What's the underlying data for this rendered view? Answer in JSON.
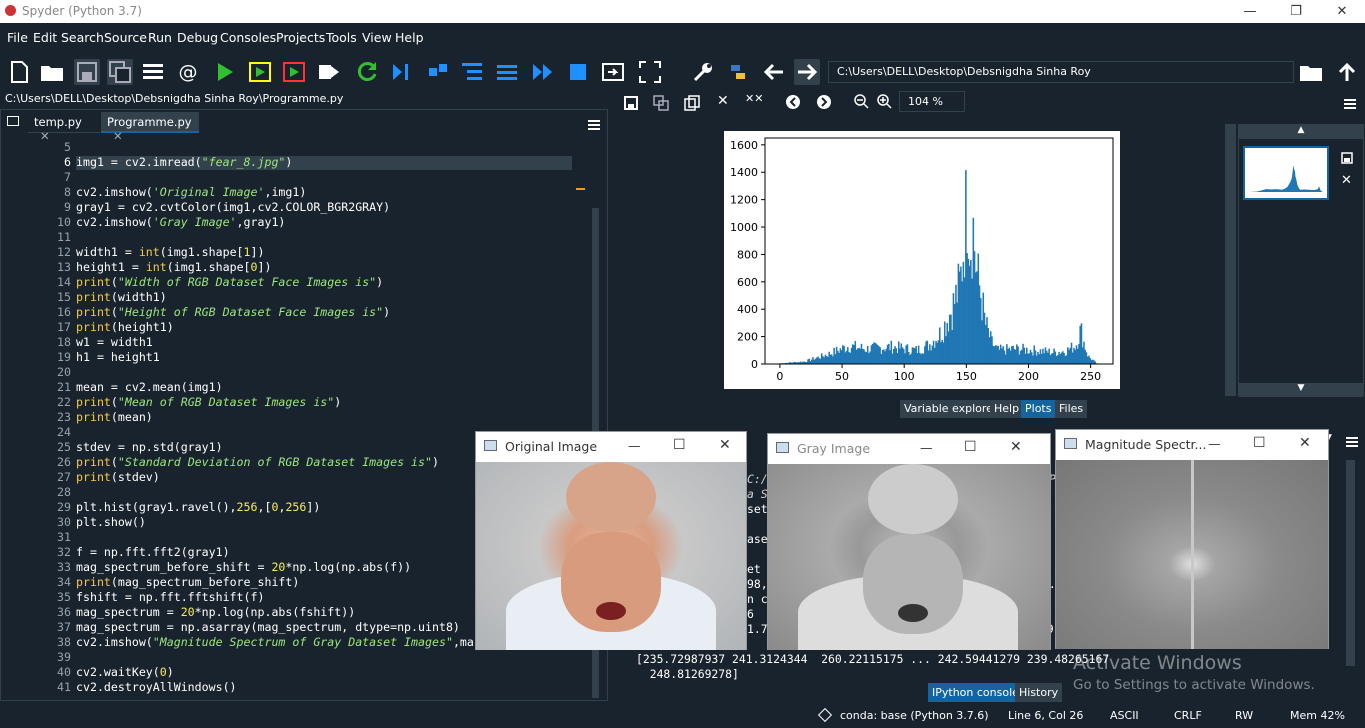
{
  "window": {
    "title": "Spyder (Python 3.7)",
    "min": "—",
    "restore": "❐",
    "close": "✕"
  },
  "menu": [
    "File",
    "Edit",
    "Search",
    "Source",
    "Run",
    "Debug",
    "Consoles",
    "Projects",
    "Tools",
    "View",
    "Help"
  ],
  "toolbar": {
    "path": "C:\\Users\\DELL\\Desktop\\Debsnigdha Sinha Roy"
  },
  "editor": {
    "path": "C:\\Users\\DELL\\Desktop\\Debsnigdha Sinha Roy\\Programme.py",
    "tabs": [
      {
        "label": "temp.py"
      },
      {
        "label": "Programme.py"
      }
    ],
    "tab_close": "✕",
    "lines": [
      {
        "n": "5",
        "t": ""
      },
      {
        "n": "6",
        "t": "img1 = cv2.imread(\"fear_8.jpg\")"
      },
      {
        "n": "7",
        "t": ""
      },
      {
        "n": "8",
        "t": "cv2.imshow('Original Image',img1)"
      },
      {
        "n": "9",
        "t": "gray1 = cv2.cvtColor(img1,cv2.COLOR_BGR2GRAY)"
      },
      {
        "n": "10",
        "t": "cv2.imshow('Gray Image',gray1)"
      },
      {
        "n": "11",
        "t": ""
      },
      {
        "n": "12",
        "t": "width1 = int(img1.shape[1])"
      },
      {
        "n": "13",
        "t": "height1 = int(img1.shape[0])"
      },
      {
        "n": "14",
        "t": "print(\"Width of RGB Dataset Face Images is\")"
      },
      {
        "n": "15",
        "t": "print(width1)"
      },
      {
        "n": "16",
        "t": "print(\"Height of RGB Dataset Face Images is\")"
      },
      {
        "n": "17",
        "t": "print(height1)"
      },
      {
        "n": "18",
        "t": "w1 = width1"
      },
      {
        "n": "19",
        "t": "h1 = height1"
      },
      {
        "n": "20",
        "t": ""
      },
      {
        "n": "21",
        "t": "mean = cv2.mean(img1)"
      },
      {
        "n": "22",
        "t": "print(\"Mean of RGB Dataset Images is\")"
      },
      {
        "n": "23",
        "t": "print(mean)"
      },
      {
        "n": "24",
        "t": ""
      },
      {
        "n": "25",
        "t": "stdev = np.std(gray1)"
      },
      {
        "n": "26",
        "t": "print(\"Standard Deviation of RGB Dataset Images is\")"
      },
      {
        "n": "27",
        "t": "print(stdev)"
      },
      {
        "n": "28",
        "t": ""
      },
      {
        "n": "29",
        "t": "plt.hist(gray1.ravel(),256,[0,256])"
      },
      {
        "n": "30",
        "t": "plt.show()"
      },
      {
        "n": "31",
        "t": ""
      },
      {
        "n": "32",
        "t": "f = np.fft.fft2(gray1)"
      },
      {
        "n": "33",
        "t": "mag_spectrum_before_shift = 20*np.log(np.abs(f))"
      },
      {
        "n": "34",
        "t": "print(mag_spectrum_before_shift)"
      },
      {
        "n": "35",
        "t": "fshift = np.fft.fftshift(f)"
      },
      {
        "n": "36",
        "t": "mag_spectrum = 20*np.log(np.abs(fshift))"
      },
      {
        "n": "37",
        "t": "mag_spectrum = np.asarray(mag_spectrum, dtype=np.uint8)"
      },
      {
        "n": "38",
        "t": "cv2.imshow(\"Magnitude Spectrum of Gray Dataset Images\",ma"
      },
      {
        "n": "39",
        "t": ""
      },
      {
        "n": "40",
        "t": "cv2.waitKey(0)"
      },
      {
        "n": "41",
        "t": "cv2.destroyAllWindows()"
      }
    ]
  },
  "plots": {
    "zoom": "104 %",
    "tabs": [
      "Variable explorer",
      "Help",
      "Plots",
      "Files"
    ],
    "active_tab": "Plots"
  },
  "chart_data": {
    "type": "bar",
    "xlim": [
      -12,
      268
    ],
    "ylim": [
      0,
      1650
    ],
    "xticks": [
      "0",
      "50",
      "100",
      "150",
      "200",
      "250"
    ],
    "yticks": [
      "0",
      "200",
      "400",
      "600",
      "800",
      "1000",
      "1200",
      "1400",
      "1600"
    ],
    "color": "#1f77b4",
    "peaks": [
      [
        0,
        5
      ],
      [
        20,
        18
      ],
      [
        40,
        75
      ],
      [
        55,
        130
      ],
      [
        70,
        110
      ],
      [
        90,
        125
      ],
      [
        110,
        100
      ],
      [
        120,
        140
      ],
      [
        130,
        230
      ],
      [
        140,
        440
      ],
      [
        145,
        590
      ],
      [
        148,
        890
      ],
      [
        151,
        1280
      ],
      [
        153,
        850
      ],
      [
        155,
        1050
      ],
      [
        158,
        680
      ],
      [
        162,
        490
      ],
      [
        165,
        300
      ],
      [
        170,
        160
      ],
      [
        175,
        100
      ],
      [
        190,
        110
      ],
      [
        210,
        95
      ],
      [
        220,
        85
      ],
      [
        230,
        95
      ],
      [
        238,
        135
      ],
      [
        242,
        250
      ],
      [
        245,
        140
      ],
      [
        248,
        55
      ],
      [
        255,
        3
      ]
    ]
  },
  "console": {
    "lines": [
      "C:/",
      "a S",
      "set",
      "",
      "ase",
      "",
      "et",
      "98,",
      "n c",
      "6",
      "1.7",
      "",
      "[235.72987937 241.3124344  260.22115175 ... 242.59441279 239.48265167",
      "  248.81269278]"
    ],
    "tabs": [
      "IPython console",
      "History"
    ],
    "active_tab": "IPython console",
    "frag_a": "/P",
    "frag_b": "0.",
    "frag_c": "269"
  },
  "windows": [
    {
      "title": "Original Image"
    },
    {
      "title": "Gray Image"
    },
    {
      "title": "Magnitude Spectr..."
    }
  ],
  "watermark": {
    "title": "Activate Windows",
    "subtitle": "Go to Settings to activate Windows."
  },
  "status": {
    "env": "conda: base (Python 3.7.6)",
    "pos": "Line 6, Col 26",
    "encoding": "ASCII",
    "eol": "CRLF",
    "perm": "RW",
    "mem": "Mem 42%"
  },
  "colors": {
    "bg": "#19232d",
    "border": "#32414b",
    "accent": "#1464a0"
  }
}
